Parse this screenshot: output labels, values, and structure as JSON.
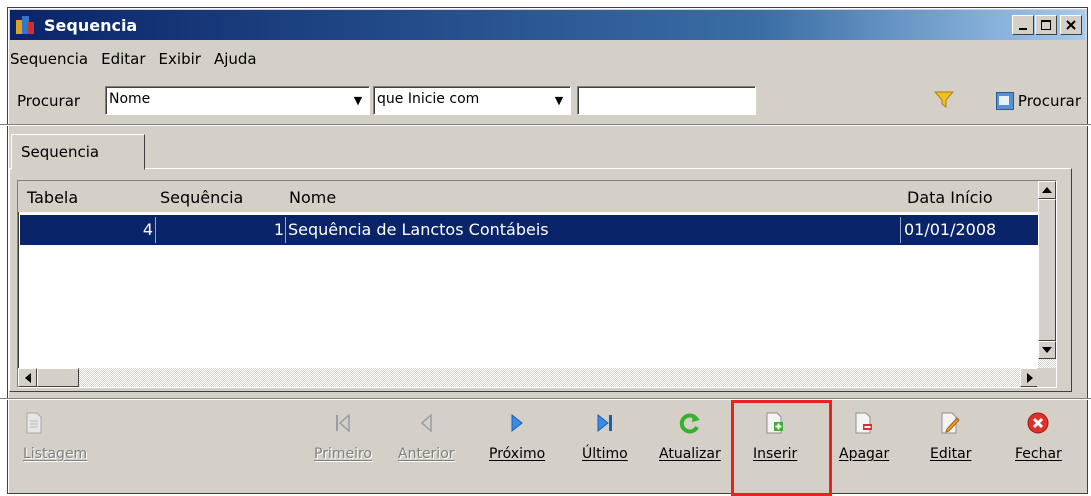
{
  "window": {
    "title": "Sequencia"
  },
  "menu": [
    "Sequencia",
    "Editar",
    "Exibir",
    "Ajuda"
  ],
  "search": {
    "label": "Procurar",
    "field": "Nome",
    "condition": "que Inicie com",
    "value": "",
    "button_label": "Procurar"
  },
  "tab": {
    "label": "Sequencia"
  },
  "grid": {
    "columns": [
      "Tabela",
      "Sequência",
      "Nome",
      "Data Início"
    ],
    "rows": [
      {
        "tabela": "4",
        "sequencia": "1",
        "nome": "Sequência de Lanctos Contábeis",
        "data_inicio": "01/01/2008",
        "selected": true
      }
    ]
  },
  "toolbar": {
    "listagem": "Listagem",
    "primeiro": "Primeiro",
    "anterior": "Anterior",
    "proximo": "Próximo",
    "ultimo": "Último",
    "atualizar": "Atualizar",
    "inserir": "Inserir",
    "apagar": "Apagar",
    "editar": "Editar",
    "fechar": "Fechar"
  },
  "colors": {
    "selection": "#0a246a",
    "highlight_box": "#e8231f",
    "title_bar": "#0a246a"
  }
}
